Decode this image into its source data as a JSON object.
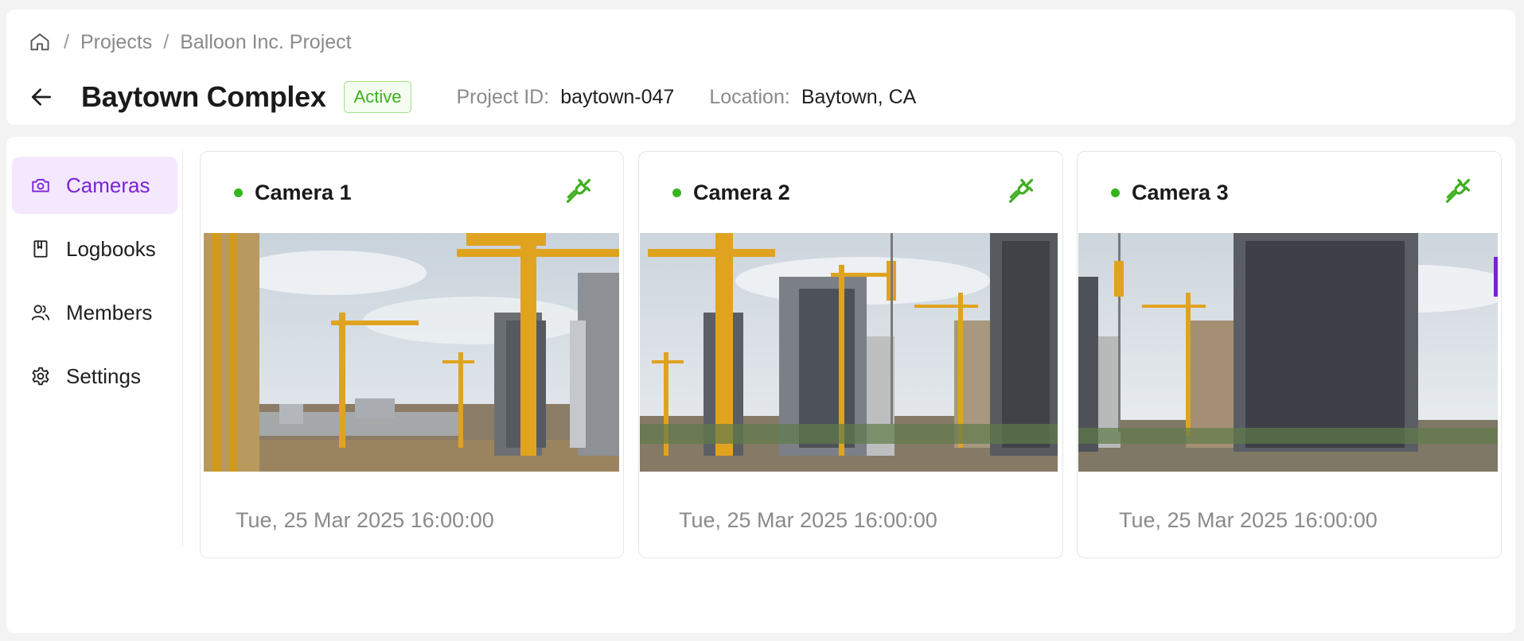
{
  "breadcrumb": {
    "home_icon": "home-icon",
    "items": [
      "Projects",
      "Balloon Inc. Project"
    ],
    "separator": "/"
  },
  "project": {
    "title": "Baytown Complex",
    "status": "Active",
    "id_label": "Project ID:",
    "id_value": "baytown-047",
    "location_label": "Location:",
    "location_value": "Baytown, CA"
  },
  "sidebar": {
    "items": [
      {
        "label": "Cameras",
        "icon": "camera-icon",
        "active": true
      },
      {
        "label": "Logbooks",
        "icon": "book-icon",
        "active": false
      },
      {
        "label": "Members",
        "icon": "users-icon",
        "active": false
      },
      {
        "label": "Settings",
        "icon": "gear-icon",
        "active": false
      }
    ]
  },
  "cameras": [
    {
      "name": "Camera 1",
      "status": "online",
      "timestamp": "Tue, 25 Mar 2025 16:00:00"
    },
    {
      "name": "Camera 2",
      "status": "online",
      "timestamp": "Tue, 25 Mar 2025 16:00:00"
    },
    {
      "name": "Camera 3",
      "status": "online",
      "timestamp": "Tue, 25 Mar 2025 16:00:00"
    }
  ],
  "colors": {
    "accent": "#7a22d6",
    "accent_bg": "#f3e8ff",
    "online": "#35b51d",
    "badge_border": "#9ee08a"
  }
}
